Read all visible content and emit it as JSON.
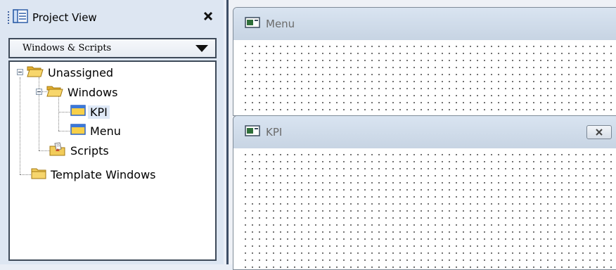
{
  "panel": {
    "title": "Project View",
    "close_glyph": "✕",
    "icon": "project-view-icon"
  },
  "selector": {
    "value": "Windows & Scripts"
  },
  "tree": {
    "unassigned": "Unassigned",
    "windows": "Windows",
    "kpi": "KPI",
    "menu": "Menu",
    "scripts": "Scripts",
    "template_windows": "Template Windows",
    "selected_item": "KPI"
  },
  "windows": {
    "menu": {
      "title": "Menu",
      "icon": "window-icon"
    },
    "kpi": {
      "title": "KPI",
      "icon": "window-icon",
      "close_glyph": "✕"
    }
  },
  "colors": {
    "panel_bg": "#dde6f2",
    "folder_yellow": "#f5c542",
    "accent_blue": "#3a6fc4",
    "title_bar": "#cfdcea"
  }
}
